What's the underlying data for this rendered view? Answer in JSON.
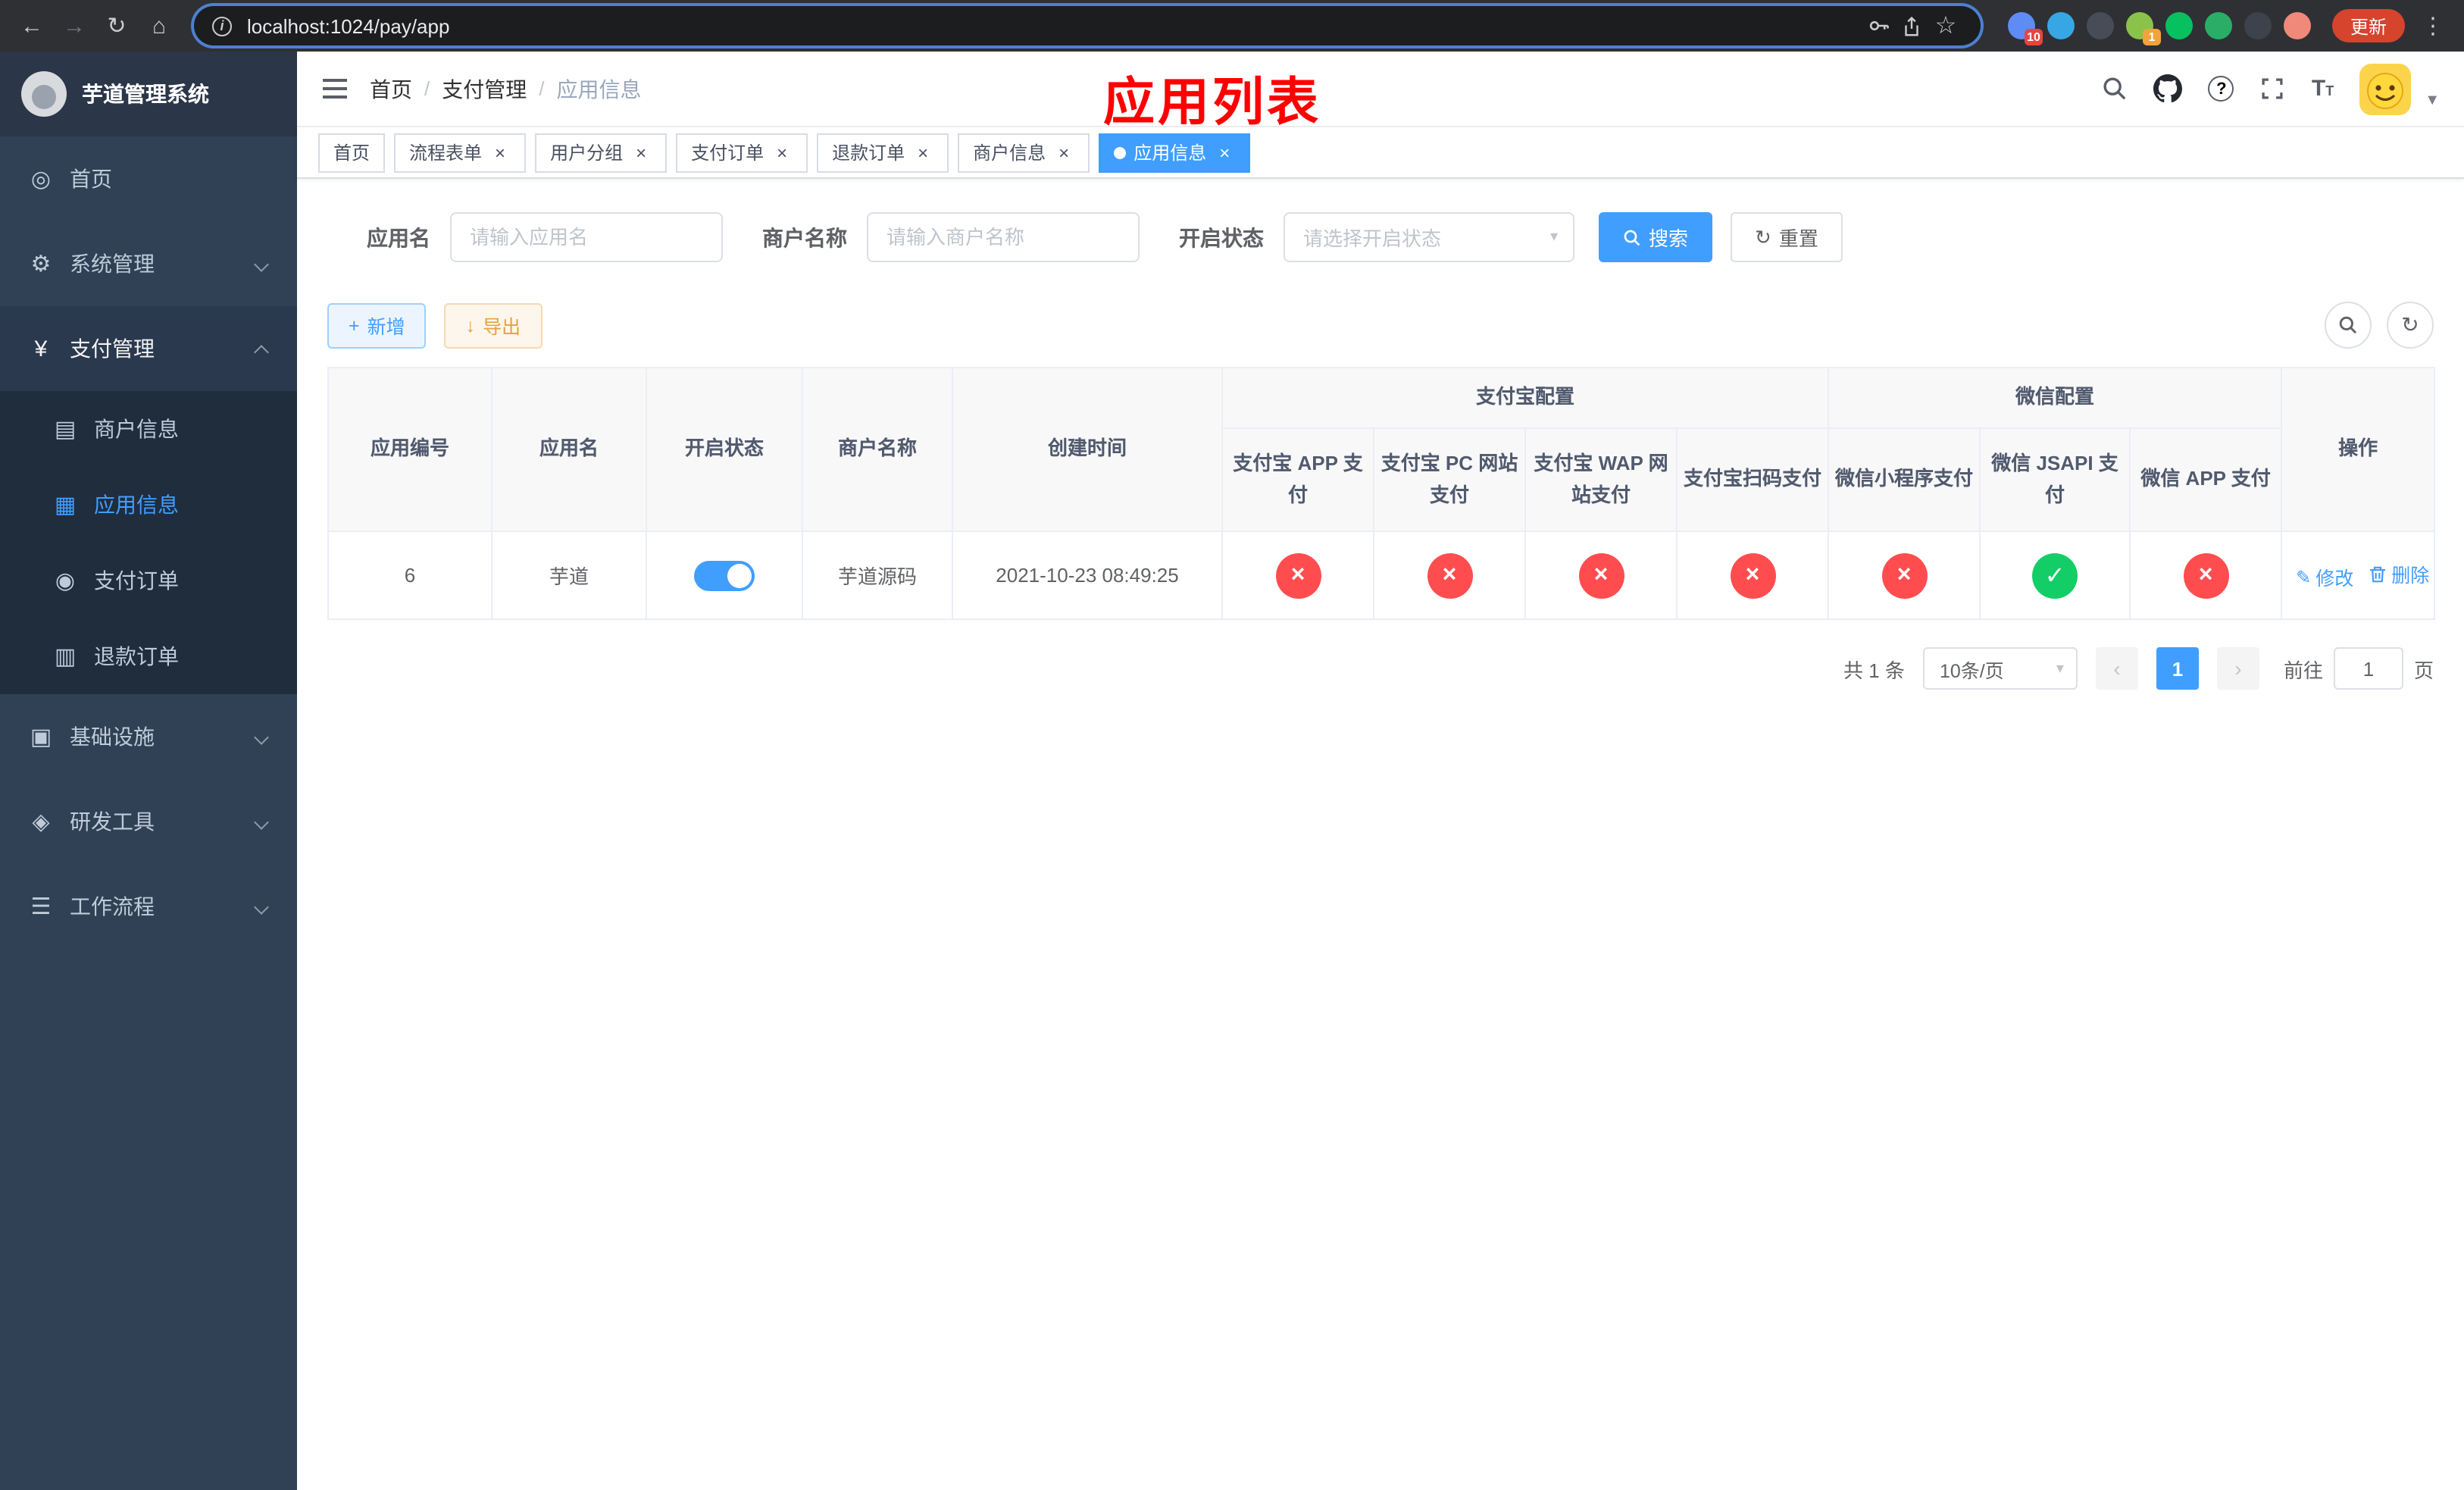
{
  "browser": {
    "url": "localhost:1024/pay/app",
    "update_label": "更新",
    "extensions": [
      {
        "key": "puzzle",
        "color": "#5f8bf5",
        "badge": "10",
        "badge_color": "#e8453c"
      },
      {
        "key": "drop",
        "color": "#37a7e4"
      },
      {
        "key": "globe",
        "color": "#474d57"
      },
      {
        "key": "colorful",
        "color": "#8bc34a",
        "badge": "1",
        "badge_color": "#f2a33c"
      },
      {
        "key": "wechat-dev",
        "color": "#07c160"
      },
      {
        "key": "chat",
        "color": "#2aae67"
      },
      {
        "key": "monkey",
        "color": "#3d434c"
      },
      {
        "key": "face",
        "color": "#f0897a"
      }
    ]
  },
  "sidebar": {
    "title": "芋道管理系统",
    "items": [
      {
        "key": "home",
        "label": "首页",
        "icon": "dashboard-icon"
      },
      {
        "key": "system",
        "label": "系统管理",
        "icon": "gear-icon",
        "chevron": true
      },
      {
        "key": "payment",
        "label": "支付管理",
        "icon": "yen-icon",
        "chevron": true,
        "expanded": true,
        "children": [
          {
            "key": "merchant-info",
            "label": "商户信息",
            "icon": "card-icon"
          },
          {
            "key": "app-info",
            "label": "应用信息",
            "icon": "grid-icon",
            "active": true
          },
          {
            "key": "payment-order",
            "label": "支付订单",
            "icon": "order-icon"
          },
          {
            "key": "refund-order",
            "label": "退款订单",
            "icon": "refund-icon"
          }
        ]
      },
      {
        "key": "infrastructure",
        "label": "基础设施",
        "icon": "infra-icon",
        "chevron": true
      },
      {
        "key": "dev-tools",
        "label": "研发工具",
        "icon": "tools-icon",
        "chevron": true
      },
      {
        "key": "workflow",
        "label": "工作流程",
        "icon": "workflow-icon",
        "chevron": true
      }
    ]
  },
  "navbar": {
    "breadcrumb": [
      {
        "label": "首页"
      },
      {
        "label": "支付管理"
      },
      {
        "label": "应用信息",
        "current": true
      }
    ]
  },
  "overlay": {
    "title": "应用列表",
    "color": "#ff0000"
  },
  "tags_view": {
    "tabs": [
      {
        "key": "home",
        "label": "首页"
      },
      {
        "key": "process-form",
        "label": "流程表单",
        "closable": true
      },
      {
        "key": "user-group",
        "label": "用户分组",
        "closable": true
      },
      {
        "key": "payment-order",
        "label": "支付订单",
        "closable": true
      },
      {
        "key": "refund-order",
        "label": "退款订单",
        "closable": true
      },
      {
        "key": "merchant-info",
        "label": "商户信息",
        "closable": true
      },
      {
        "key": "app-info",
        "label": "应用信息",
        "closable": true,
        "active": true
      }
    ]
  },
  "filters": {
    "app_name_label": "应用名",
    "app_name_placeholder": "请输入应用名",
    "merchant_label": "商户名称",
    "merchant_placeholder": "请输入商户名称",
    "status_label": "开启状态",
    "status_placeholder": "请选择开启状态",
    "search_button": "搜索",
    "reset_button": "重置"
  },
  "toolbar": {
    "add_label": "新增",
    "export_label": "导出"
  },
  "table": {
    "simple_columns": [
      "应用编号",
      "应用名",
      "开启状态",
      "商户名称",
      "创建时间"
    ],
    "alipay_group": {
      "label": "支付宝配置",
      "columns": [
        "支付宝 APP 支付",
        "支付宝 PC 网站支付",
        "支付宝 WAP 网站支付",
        "支付宝扫码支付"
      ]
    },
    "wechat_group": {
      "label": "微信配置",
      "columns": [
        "微信小程序支付",
        "微信 JSAPI 支付",
        "微信 APP 支付"
      ]
    },
    "actions_column": "操作",
    "rows": [
      {
        "app_id": "6",
        "app_name": "芋道",
        "enabled": true,
        "merchant_name": "芋道源码",
        "created_at": "2021-10-23 08:49:25",
        "pay_statuses": [
          false,
          false,
          false,
          false,
          false,
          true,
          false
        ],
        "edit_label": "修改",
        "delete_label": "删除"
      }
    ]
  },
  "pagination": {
    "total_text": "共 1 条",
    "page_size": "10条/页",
    "current_page": "1",
    "goto_prefix": "前往",
    "goto_suffix": "页",
    "goto_value": "1"
  },
  "colors": {
    "accent": "#409eff",
    "success": "#13ce66",
    "danger": "#ff4d4f"
  }
}
